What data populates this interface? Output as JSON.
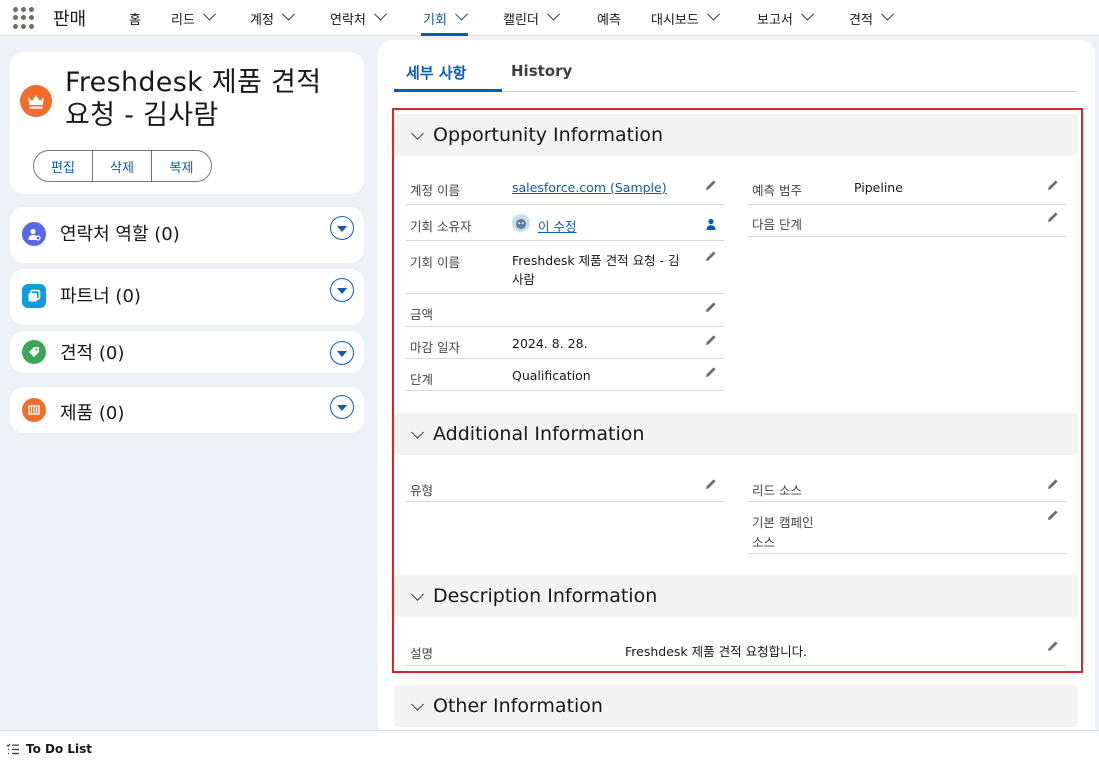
{
  "nav": {
    "app_name": "판매",
    "items": [
      {
        "label": "홈",
        "has_menu": false
      },
      {
        "label": "리드",
        "has_menu": true
      },
      {
        "label": "계정",
        "has_menu": true
      },
      {
        "label": "연락처",
        "has_menu": true
      },
      {
        "label": "기회",
        "has_menu": true,
        "active": true
      },
      {
        "label": "캘린더",
        "has_menu": true
      },
      {
        "label": "예측",
        "has_menu": false
      },
      {
        "label": "대시보드",
        "has_menu": true
      },
      {
        "label": "보고서",
        "has_menu": true
      },
      {
        "label": "견적",
        "has_menu": true
      }
    ]
  },
  "highlight": {
    "title": "Freshdesk 제품 견적 요청 - 김사람",
    "buttons": {
      "edit": "편집",
      "delete": "삭제",
      "clone": "복제"
    }
  },
  "related": [
    {
      "label": "연락처 역할",
      "count": "(0)",
      "icon": "contact-role-icon",
      "color": "#5867e8"
    },
    {
      "label": "파트너",
      "count": "(0)",
      "icon": "partner-icon",
      "color": "#0d9dda"
    },
    {
      "label": "견적",
      "count": "(0)",
      "icon": "quote-icon",
      "color": "#3ba755"
    },
    {
      "label": "제품",
      "count": "(0)",
      "icon": "product-icon",
      "color": "#f26d2b"
    }
  ],
  "tabs": {
    "details": "세부 사항",
    "history": "History"
  },
  "sections": {
    "opportunity": "Opportunity Information",
    "additional": "Additional Information",
    "description": "Description Information",
    "other": "Other Information"
  },
  "fields": {
    "account_name": {
      "label": "계정 이름",
      "value": "salesforce.com (Sample)"
    },
    "owner": {
      "label": "기회 소유자",
      "value": "이 수정"
    },
    "opp_name": {
      "label": "기회 이름",
      "value_line1": "Freshdesk 제품 견적 요청 - 김",
      "value_line2": "사람"
    },
    "amount": {
      "label": "금액",
      "value": ""
    },
    "close_date": {
      "label": "마감 일자",
      "value": "2024. 8. 28."
    },
    "stage": {
      "label": "단계",
      "value": "Qualification"
    },
    "forecast_category": {
      "label": "예측 범주",
      "value": "Pipeline"
    },
    "next_step": {
      "label": "다음 단계",
      "value": ""
    },
    "type": {
      "label": "유형",
      "value": ""
    },
    "lead_source": {
      "label": "리드 소스",
      "value": ""
    },
    "campaign_source": {
      "label_line1": "기본 캠페인",
      "label_line2": "소스",
      "value": ""
    },
    "description": {
      "label": "설명",
      "value": "Freshdesk 제품 견적 요청합니다."
    }
  },
  "footer": {
    "todo_label": "To Do List"
  },
  "colors": {
    "brand_blue": "#0b5cab",
    "highlight_red": "#e0202a",
    "opp_orange": "#f26d2b"
  }
}
